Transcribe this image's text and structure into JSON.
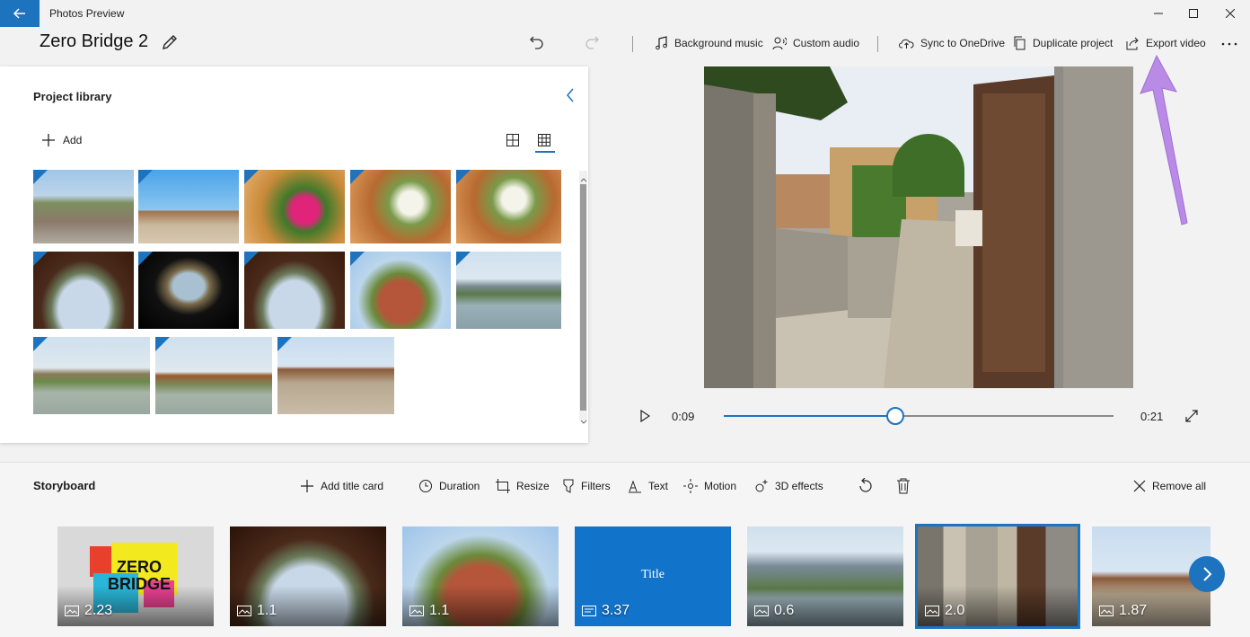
{
  "window": {
    "app_title": "Photos Preview"
  },
  "project": {
    "title": "Zero Bridge 2"
  },
  "toolbar": {
    "background_music": "Background music",
    "custom_audio": "Custom audio",
    "sync_onedrive": "Sync to OneDrive",
    "duplicate_project": "Duplicate project",
    "export_video": "Export video"
  },
  "library": {
    "title": "Project library",
    "add_label": "Add"
  },
  "player": {
    "current_time": "0:09",
    "total_time": "0:21",
    "progress": 0.44
  },
  "storyboard": {
    "title": "Storyboard",
    "tools": {
      "add_title_card": "Add title card",
      "duration": "Duration",
      "resize": "Resize",
      "filters": "Filters",
      "text": "Text",
      "motion": "Motion",
      "effects_3d": "3D effects",
      "remove_all": "Remove all"
    },
    "clips": [
      {
        "duration": "2.23",
        "kind": "title-image"
      },
      {
        "duration": "1.1",
        "kind": "photo"
      },
      {
        "duration": "1.1",
        "kind": "photo"
      },
      {
        "duration": "3.37",
        "kind": "title-card"
      },
      {
        "duration": "0.6",
        "kind": "photo"
      },
      {
        "duration": "2.0",
        "kind": "photo",
        "selected": true
      },
      {
        "duration": "1.87",
        "kind": "photo"
      }
    ],
    "title_card_text": "Title",
    "first_clip_text_line1": "ZERO",
    "first_clip_text_line2": "BRIDGE"
  },
  "colors": {
    "accent": "#1e73be",
    "annotation_arrow": "#b98be6"
  }
}
